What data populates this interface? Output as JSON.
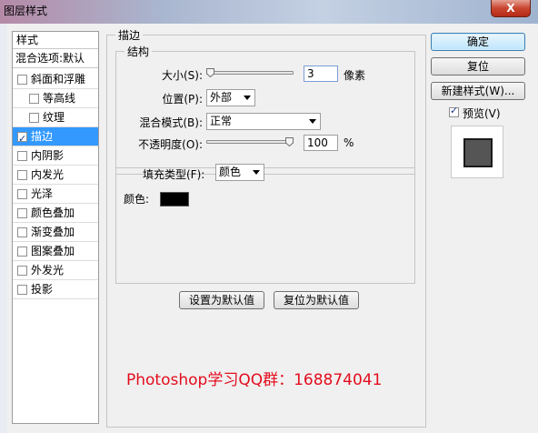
{
  "window": {
    "title": "图层样式",
    "close_label": "X"
  },
  "styles_panel": {
    "header": "样式",
    "blend_options": "混合选项:默认",
    "items": [
      {
        "label": "斜面和浮雕",
        "checked": false,
        "indent": false,
        "selected": false
      },
      {
        "label": "等高线",
        "checked": false,
        "indent": true,
        "selected": false
      },
      {
        "label": "纹理",
        "checked": false,
        "indent": true,
        "selected": false
      },
      {
        "label": "描边",
        "checked": true,
        "indent": false,
        "selected": true
      },
      {
        "label": "内阴影",
        "checked": false,
        "indent": false,
        "selected": false
      },
      {
        "label": "内发光",
        "checked": false,
        "indent": false,
        "selected": false
      },
      {
        "label": "光泽",
        "checked": false,
        "indent": false,
        "selected": false
      },
      {
        "label": "颜色叠加",
        "checked": false,
        "indent": false,
        "selected": false
      },
      {
        "label": "渐变叠加",
        "checked": false,
        "indent": false,
        "selected": false
      },
      {
        "label": "图案叠加",
        "checked": false,
        "indent": false,
        "selected": false
      },
      {
        "label": "外发光",
        "checked": false,
        "indent": false,
        "selected": false
      },
      {
        "label": "投影",
        "checked": false,
        "indent": false,
        "selected": false
      }
    ]
  },
  "stroke": {
    "section_title": "描边",
    "structure_title": "结构",
    "size_label": "大小(S):",
    "size_value": "3",
    "size_unit": "像素",
    "position_label": "位置(P):",
    "position_value": "外部",
    "blend_mode_label": "混合模式(B):",
    "blend_mode_value": "正常",
    "opacity_label": "不透明度(O):",
    "opacity_value": "100",
    "opacity_unit": "%",
    "size_slider_level": 0.0,
    "opacity_slider_level": 1.0,
    "fill_type_label": "填充类型(F):",
    "fill_type_value": "颜色",
    "color_label": "颜色:",
    "color_hex": "#000000",
    "make_default_label": "设置为默认值",
    "reset_default_label": "复位为默认值"
  },
  "actions": {
    "ok_label": "确定",
    "reset_label": "复位",
    "new_style_label": "新建样式(W)...",
    "preview_label": "预览(V)",
    "preview_checked": true
  },
  "watermark": "Photoshop学习QQ群：168874041",
  "colors": {
    "selection": "#3399ff",
    "watermark": "#e30d1e",
    "preview_fill": "#555555"
  }
}
